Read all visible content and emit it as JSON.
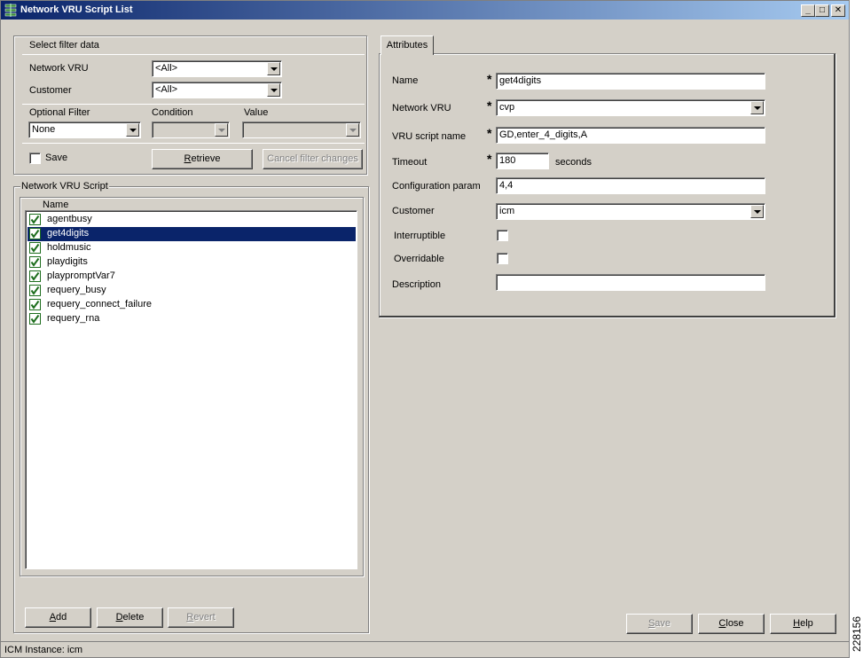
{
  "window": {
    "title": "Network VRU Script List"
  },
  "filter": {
    "group_label": "Select filter data",
    "network_vru_label": "Network VRU",
    "network_vru_value": "<All>",
    "customer_label": "Customer",
    "customer_value": "<All>",
    "optional_filter_label": "Optional Filter",
    "optional_filter_value": "None",
    "condition_label": "Condition",
    "condition_value": "",
    "value_label": "Value",
    "value_value": "",
    "save_label": "Save",
    "save_checked": false,
    "retrieve_label": "Retrieve",
    "retrieve_mnemonic": "R",
    "retrieve_rest": "etrieve",
    "cancel_label": "Cancel filter changes"
  },
  "script_list": {
    "group_label": "Network VRU Script",
    "column_header": "Name",
    "items": [
      {
        "label": "agentbusy",
        "selected": false
      },
      {
        "label": "get4digits",
        "selected": true
      },
      {
        "label": "holdmusic",
        "selected": false
      },
      {
        "label": "playdigits",
        "selected": false
      },
      {
        "label": "playpromptVar7",
        "selected": false
      },
      {
        "label": "requery_busy",
        "selected": false
      },
      {
        "label": "requery_connect_failure",
        "selected": false
      },
      {
        "label": "requery_rna",
        "selected": false
      }
    ],
    "add_mnemonic": "A",
    "add_rest": "dd",
    "delete_mnemonic": "D",
    "delete_rest": "elete",
    "revert_mnemonic": "R",
    "revert_rest": "evert"
  },
  "attributes": {
    "tab_label": "Attributes",
    "name_label": "Name",
    "name_value": "get4digits",
    "network_vru_label": "Network VRU",
    "network_vru_value": "cvp",
    "vru_script_name_label": "VRU script name",
    "vru_script_name_value": "GD,enter_4_digits,A",
    "timeout_label": "Timeout",
    "timeout_value": "180",
    "timeout_unit": "seconds",
    "config_param_label": "Configuration param",
    "config_param_value": "4,4",
    "customer_label": "Customer",
    "customer_value": "icm",
    "interruptible_label": "Interruptible",
    "interruptible_checked": false,
    "overridable_label": "Overridable",
    "overridable_checked": false,
    "description_label": "Description",
    "description_value": "",
    "required_marker": "*"
  },
  "footer": {
    "save_mnemonic": "S",
    "save_rest": "ave",
    "close_mnemonic": "C",
    "close_rest": "lose",
    "help_mnemonic": "H",
    "help_rest": "elp"
  },
  "status": {
    "text": "ICM Instance: icm"
  },
  "side_id": "228156",
  "colors": {
    "face": "#d4d0c8",
    "title_start": "#0a246a",
    "title_end": "#a6caf0",
    "selection": "#0a246a",
    "check_green": "#1e6e1e"
  }
}
